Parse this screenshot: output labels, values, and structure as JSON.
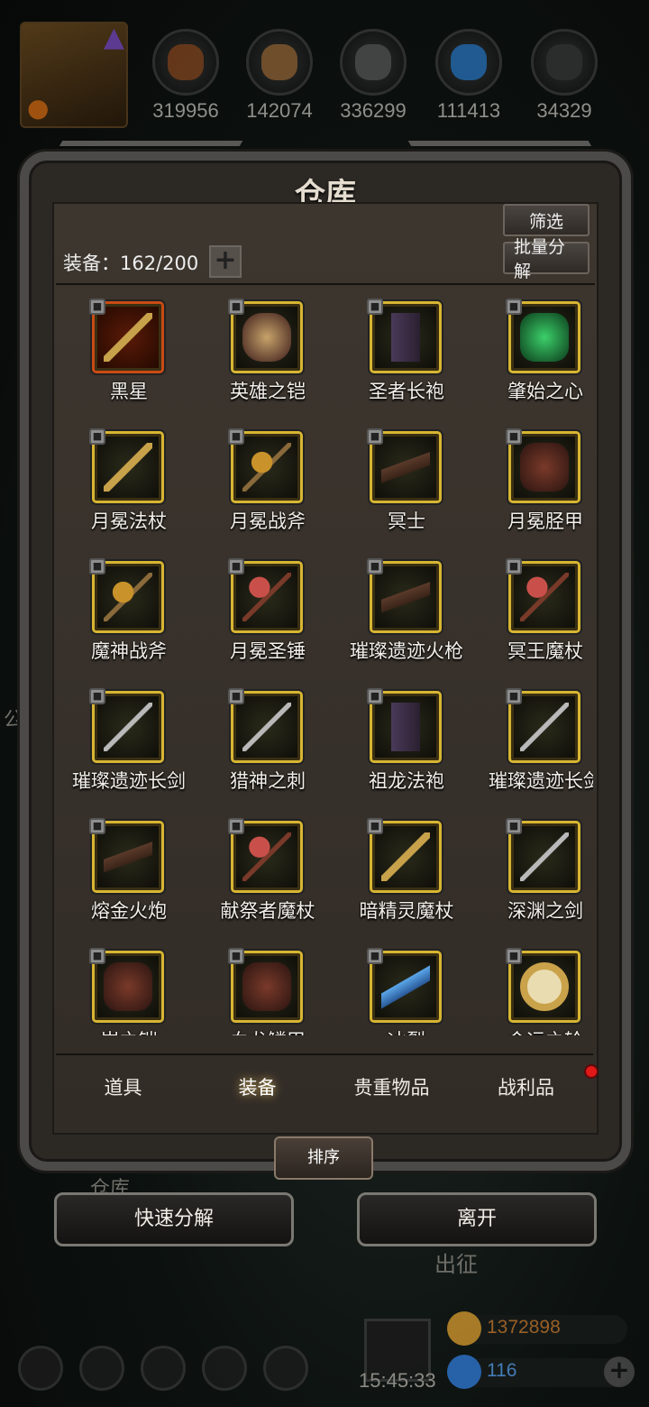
{
  "resources": [
    {
      "name": "meat",
      "value": "319956",
      "color": "#8a4a20"
    },
    {
      "name": "wood",
      "value": "142074",
      "color": "#9a6a3a"
    },
    {
      "name": "iron",
      "value": "336299",
      "color": "#5a5a5a"
    },
    {
      "name": "crystal",
      "value": "111413",
      "color": "#2a7ac9"
    },
    {
      "name": "ore",
      "value": "34329",
      "color": "#3a3a3a"
    }
  ],
  "panel": {
    "title": "仓库",
    "filter_label": "筛选",
    "bulk_disassemble_label": "批量分解",
    "capacity_label": "装备：162/200",
    "expand_label": "+"
  },
  "items": [
    {
      "name": "黑星",
      "art": "staff",
      "frame": "red"
    },
    {
      "name": "英雄之铠",
      "art": "skull",
      "frame": "gold"
    },
    {
      "name": "圣者长袍",
      "art": "robe",
      "frame": "gold"
    },
    {
      "name": "肇始之心",
      "art": "gem",
      "frame": "gold"
    },
    {
      "name": "月冕法杖",
      "art": "staff",
      "frame": "gold"
    },
    {
      "name": "月冕战斧",
      "art": "axe",
      "frame": "gold"
    },
    {
      "name": "冥士",
      "art": "gun",
      "frame": "gold"
    },
    {
      "name": "月冕胫甲",
      "art": "armor",
      "frame": "gold"
    },
    {
      "name": "魔神战斧",
      "art": "axe",
      "frame": "gold"
    },
    {
      "name": "月冕圣锤",
      "art": "mace",
      "frame": "gold"
    },
    {
      "name": "璀璨遗迹火枪",
      "art": "gun",
      "frame": "gold"
    },
    {
      "name": "冥王魔杖",
      "art": "mace",
      "frame": "gold"
    },
    {
      "name": "璀璨遗迹长剑",
      "art": "blade",
      "frame": "gold"
    },
    {
      "name": "猎神之刺",
      "art": "blade",
      "frame": "gold"
    },
    {
      "name": "祖龙法袍",
      "art": "robe",
      "frame": "gold"
    },
    {
      "name": "璀璨遗迹长剑",
      "art": "blade",
      "frame": "gold"
    },
    {
      "name": "熔金火炮",
      "art": "gun",
      "frame": "gold"
    },
    {
      "name": "献祭者魔杖",
      "art": "mace",
      "frame": "gold"
    },
    {
      "name": "暗精灵魔杖",
      "art": "staff",
      "frame": "gold"
    },
    {
      "name": "深渊之剑",
      "art": "blade",
      "frame": "gold"
    },
    {
      "name": "岩之铠",
      "art": "armor",
      "frame": "gold"
    },
    {
      "name": "血龙鳞甲",
      "art": "armor",
      "frame": "gold"
    },
    {
      "name": "冰裂",
      "art": "ice",
      "frame": "gold"
    },
    {
      "name": "命运之轮",
      "art": "ring",
      "frame": "gold"
    }
  ],
  "tabs": [
    {
      "label": "道具",
      "active": false,
      "dot": false
    },
    {
      "label": "装备",
      "active": true,
      "dot": false
    },
    {
      "label": "贵重物品",
      "active": false,
      "dot": false
    },
    {
      "label": "战利品",
      "active": false,
      "dot": true
    }
  ],
  "sort_label": "排序",
  "actions": {
    "quick_disassemble": "快速分解",
    "leave": "离开"
  },
  "background": {
    "warehouse_label": "仓库",
    "expedition_label": "出征",
    "side_text": "公会"
  },
  "footer": {
    "timer": "15:45:33",
    "gold": "1372898",
    "gems": "116"
  }
}
